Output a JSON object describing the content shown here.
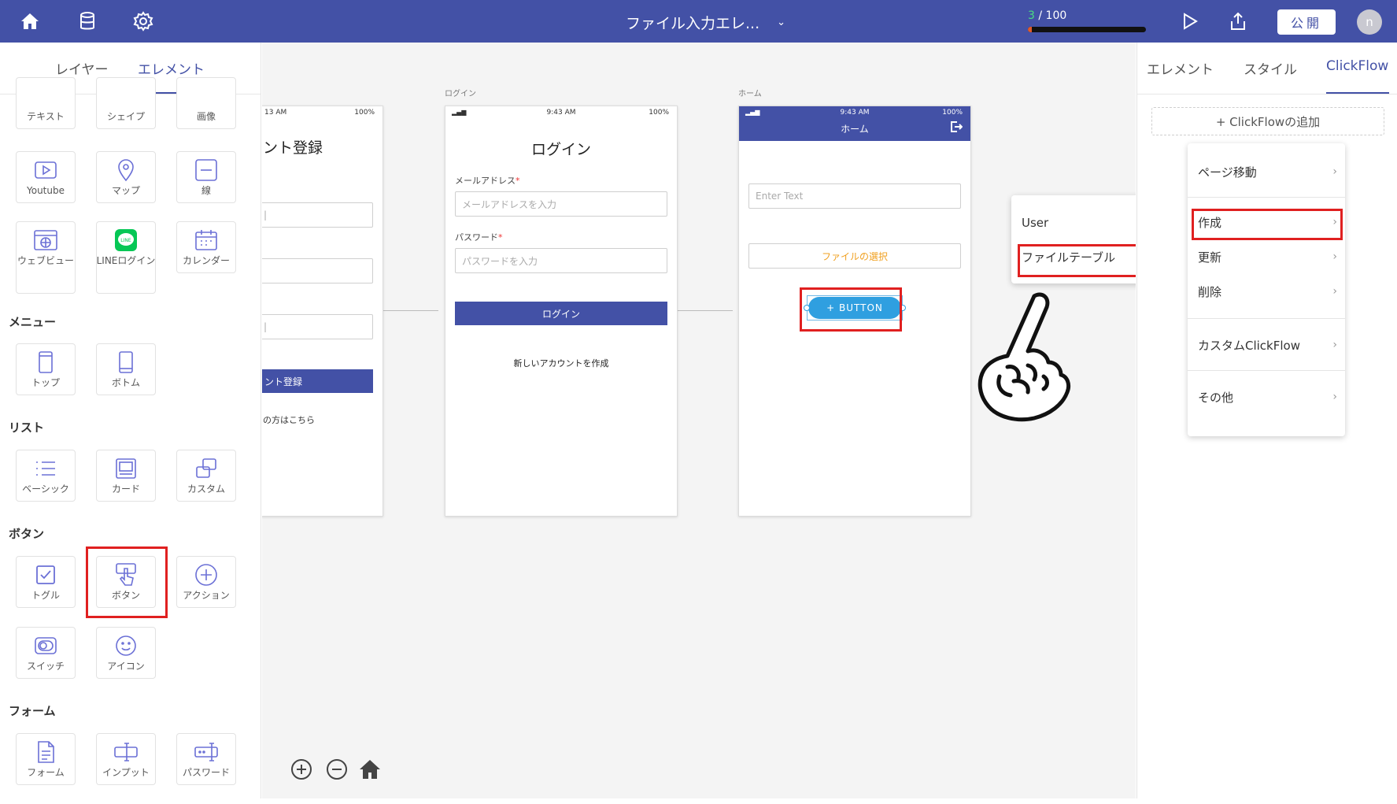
{
  "topbar": {
    "title": "ファイル入力エレ...",
    "progress_current": "3",
    "progress_total": "/ 100",
    "progress_fraction": 0.03,
    "publish_label": "公開",
    "avatar_initial": "n"
  },
  "left_panel": {
    "tabs": [
      "レイヤー",
      "エレメント"
    ],
    "active_tab": "エレメント",
    "basic_row0": [
      "テキスト",
      "シェイプ",
      "画像"
    ],
    "basic_row1": [
      "Youtube",
      "マップ",
      "線"
    ],
    "basic_row2": [
      "ウェブビュー",
      "LINEログイン",
      "カレンダー"
    ],
    "sections": {
      "menu": "メニュー",
      "list": "リスト",
      "button": "ボタン",
      "form": "フォーム"
    },
    "menu_items": [
      "トップ",
      "ボトム"
    ],
    "list_items": [
      "ベーシック",
      "カード",
      "カスタム"
    ],
    "button_items": [
      "トグル",
      "ボタン",
      "アクション"
    ],
    "button_items2": [
      "スイッチ",
      "アイコン"
    ],
    "form_items": [
      "フォーム",
      "インプット",
      "パスワード"
    ]
  },
  "canvas": {
    "screen1": {
      "status_time": "13 AM",
      "status_battery": "100%",
      "title": "ント登録",
      "button_label": "ント登録",
      "link": "の方はこちら"
    },
    "screen2": {
      "caption": "ログイン",
      "status_time": "9:43 AM",
      "status_battery": "100%",
      "title": "ログイン",
      "email_label": "メールアドレス",
      "email_placeholder": "メールアドレスを入力",
      "password_label": "パスワード",
      "password_placeholder": "パスワードを入力",
      "login_button": "ログイン",
      "create_account": "新しいアカウントを作成"
    },
    "screen3": {
      "caption": "ホーム",
      "status_time": "9:43 AM",
      "status_battery": "100%",
      "header_title": "ホーム",
      "text_input_placeholder": "Enter Text",
      "file_select": "ファイルの選択",
      "button_label": "+ BUTTON"
    }
  },
  "right_panel": {
    "tabs": [
      "エレメント",
      "スタイル",
      "ClickFlow"
    ],
    "active_tab": "ClickFlow",
    "add_clickflow": "+ ClickFlowの追加",
    "menu": [
      "ページ移動",
      "作成",
      "更新",
      "削除",
      "カスタムClickFlow",
      "その他"
    ],
    "submenu": [
      "User",
      "ファイルテーブル"
    ]
  },
  "colors": {
    "brand": "#4351a6",
    "highlight": "#e02020",
    "file_select_text": "#f0a020",
    "pill_button": "#2f9fe0"
  }
}
